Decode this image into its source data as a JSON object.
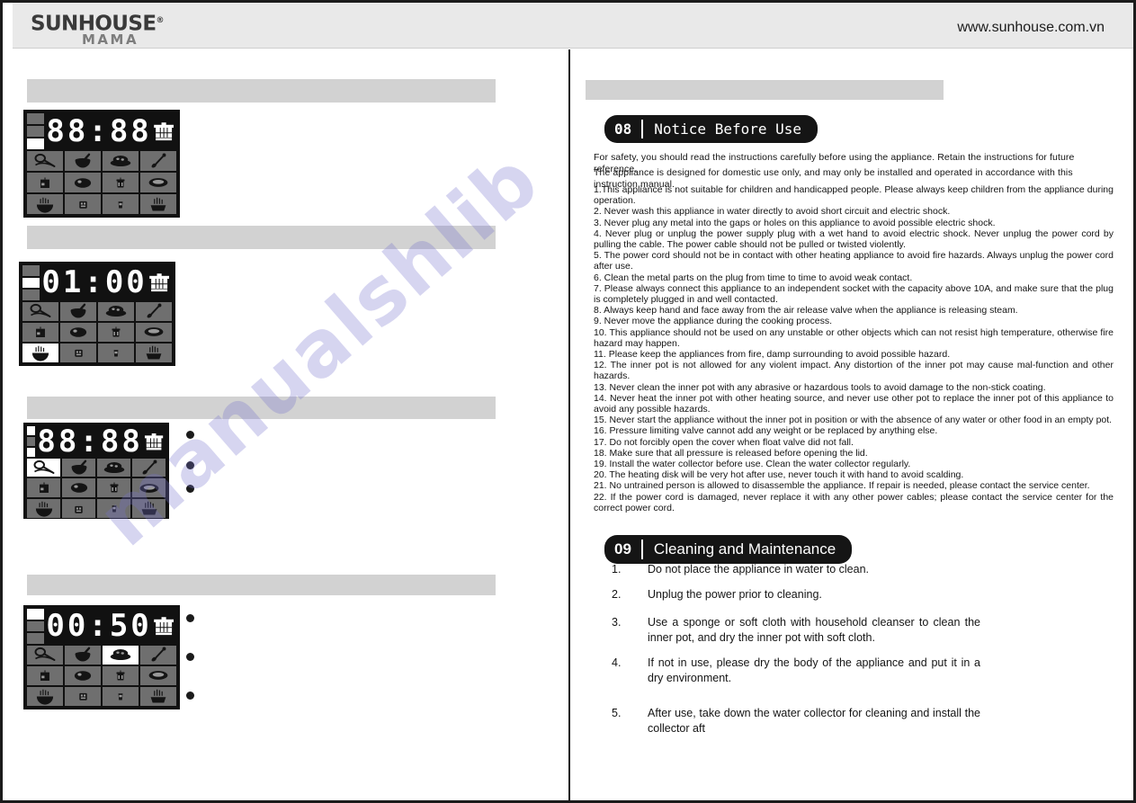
{
  "header": {
    "logo_main": "SUNHOUSE",
    "logo_reg": "®",
    "logo_sub": "MAMA",
    "site_url": "www.sunhouse.com.vn"
  },
  "watermark": {
    "text": "manualshlib"
  },
  "panels": [
    {
      "name": "panel-1",
      "display": "88:88",
      "display_digits": [
        "8",
        "8",
        "8",
        "8"
      ],
      "bars": [
        "off",
        "off",
        "on"
      ],
      "selected_button": null
    },
    {
      "name": "panel-2",
      "display": "01:00",
      "display_digits": [
        "0",
        "1",
        "0",
        "0"
      ],
      "bars": [
        "off",
        "on",
        "off"
      ],
      "selected_button": "8"
    },
    {
      "name": "panel-3",
      "display": "88:88",
      "display_digits": [
        "8",
        "8",
        "8",
        "8"
      ],
      "bars": [
        "on",
        "off",
        "on"
      ],
      "selected_button": "0"
    },
    {
      "name": "panel-4",
      "display": "00:50",
      "display_digits": [
        "0",
        "0",
        "5",
        "0"
      ],
      "bars": [
        "on",
        "off",
        "off"
      ],
      "selected_button": "2"
    }
  ],
  "panel_buttons": [
    "noodle-ladle-icon",
    "mortar-bowl-icon",
    "braised-dish-icon",
    "whisk-icon",
    "cake-icon",
    "roast-meat-icon",
    "steamer-pot-icon",
    "oval-dish-icon",
    "steaming-bowl-icon",
    "rice-cooker-icon",
    "yogurt-cup-icon",
    "steam-basket-icon"
  ],
  "notice": {
    "badge_number": "08",
    "badge_title": "Notice Before Use",
    "intro": [
      "For safety, you should read the instructions carefully before using the appliance. Retain the instructions for future reference.",
      "The appliance is designed for domestic use only, and may only be installed and operated in accordance with this instruction manual."
    ],
    "items": [
      "1.This appliance is not suitable for children and handicapped people. Please always keep children from the appliance during operation.",
      "2. Never wash this appliance in water directly to avoid short circuit and electric shock.",
      "3. Never plug any metal into the gaps or holes on this appliance to avoid possible electric shock.",
      "4. Never plug or unplug the power supply plug with a wet hand to avoid electric shock. Never unplug the power cord by pulling the cable. The power cable should not be pulled or twisted violently.",
      "5. The power cord should not be in contact with other heating appliance to avoid fire hazards. Always unplug the power cord after use.",
      "6. Clean the metal parts on the plug from time to time to avoid weak contact.",
      "7. Please always connect this appliance to an independent socket with the capacity above 10A, and make sure that the plug is completely plugged in and well contacted.",
      "8. Always keep hand and face away from the air release valve when the appliance is releasing steam.",
      "9. Never move the appliance during the cooking process.",
      "10. This appliance should not be used on any unstable or other objects which can not resist high temperature, otherwise fire hazard may happen.",
      "11.  Please keep the appliances from fire, damp surrounding to avoid possible hazard.",
      "12. The inner pot is not allowed for any violent impact. Any distortion of the inner pot may cause mal-function and other hazards.",
      "13. Never clean the inner pot with any abrasive or hazardous tools to avoid damage to the non-stick coating.",
      "14. Never heat the inner pot with other heating source, and never use other pot to replace the inner pot of this appliance to avoid any possible hazards.",
      "15. Never start the appliance without the inner pot in position or with the absence of any water or other food in an empty pot.",
      "16. Pressure limiting valve cannot add any weight or be replaced by anything else.",
      "17. Do not forcibly open the cover when float valve did not fall.",
      "18. Make sure that all pressure is released before opening the lid.",
      "19. Install the water collector before use. Clean the water collector regularly.",
      "20. The heating disk will be very hot after use, never touch it with hand to avoid scalding.",
      "21. No untrained person is allowed to disassemble the appliance. If repair is needed, please contact the service center.",
      "22. If the power cord is damaged, never replace it with any other power cables; please contact the service center for the correct power cord."
    ]
  },
  "cleaning": {
    "badge_number": "09",
    "badge_title": "Cleaning and Maintenance",
    "items": [
      {
        "num": "1.",
        "text": "Do not place the appliance in water to clean."
      },
      {
        "num": "2.",
        "text": "Unplug the power prior to cleaning."
      },
      {
        "num": "3.",
        "text": "Use a sponge or soft cloth with household cleanser to clean the inner pot, and dry the inner pot with soft cloth."
      },
      {
        "num": "4.",
        "text": "If not in use, please dry the body of the appliance and put it in a dry environment."
      },
      {
        "num": "5.",
        "text": "After use, take down the water collector for cleaning and install the collector aft"
      }
    ]
  },
  "colors": {
    "header_bg": "#e9e9e9",
    "grey_bar": "#d2d2d2",
    "panel_bg": "#111111",
    "button_bg": "#6f6f6f",
    "button_selected": "#ffffff",
    "badge_bg": "#151515",
    "watermark": "#7874cd"
  }
}
